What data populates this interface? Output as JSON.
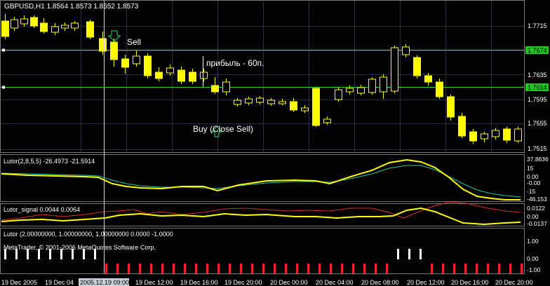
{
  "symbol_header": "GBPUSD,H1  1.8564 1.8573 1.8552 1.8573",
  "annotations": {
    "sell": "Sell",
    "profit": "прибыль - 60п.",
    "buy": "Buy (Close Sell)"
  },
  "main_chart": {
    "price_labels": [
      "1.7715",
      "1.7674",
      "1.7635",
      "1.7614",
      "1.7595",
      "1.7555",
      "1.7515"
    ],
    "horizontal_levels": [
      {
        "value": "1.7674",
        "color": "#22dd22"
      },
      {
        "value": "1.7614",
        "color": "#22dd22"
      }
    ],
    "candle_color": "#ffff00",
    "bar_color": "#ffffff",
    "grid_color": "#2a2f3f"
  },
  "lutor_panel": {
    "header": "Lutor(2,8,5,5) -26.4973 -21.5914",
    "scale_labels": [
      "37.8636",
      "15",
      "0.00",
      "-0.00",
      "-15",
      "-46.153"
    ],
    "fast_color": "#ffff00",
    "slow_color": "#20c8a0"
  },
  "signal_panel": {
    "header": "Lutor_signal 0.0044 0.0064",
    "scale_labels": [
      "0.0122",
      "0.00",
      "-0.0137"
    ],
    "line1_color": "#ffff00",
    "line2_color": "#d83020"
  },
  "bottom_panel": {
    "header": "Lutor (2.00000000, 1.00000000, 1.00000000 0.0000 -1.0000",
    "copyright": "MetaTrader, © 2001-2006 MetaQuotes Software Corp.",
    "scale_labels": [
      "1.00",
      "0.00",
      "-1.00"
    ],
    "up_color": "#ffffff",
    "down_color": "#ff2020"
  },
  "time_axis": {
    "labels": [
      "19 Dec 2005",
      "19 Dec 04",
      "2005.12.19 09:00",
      "19 Dec 12:00",
      "19 Dec 16:00",
      "19 Dec 20:00",
      "20 Dec 00:00",
      "20 Dec 04:00",
      "20 Dec 08:00",
      "20 Dec 12:00",
      "20 Dec 16:00",
      "20 Dec 20:00"
    ],
    "highlighted_label": "2005.12.19 09:00"
  }
}
